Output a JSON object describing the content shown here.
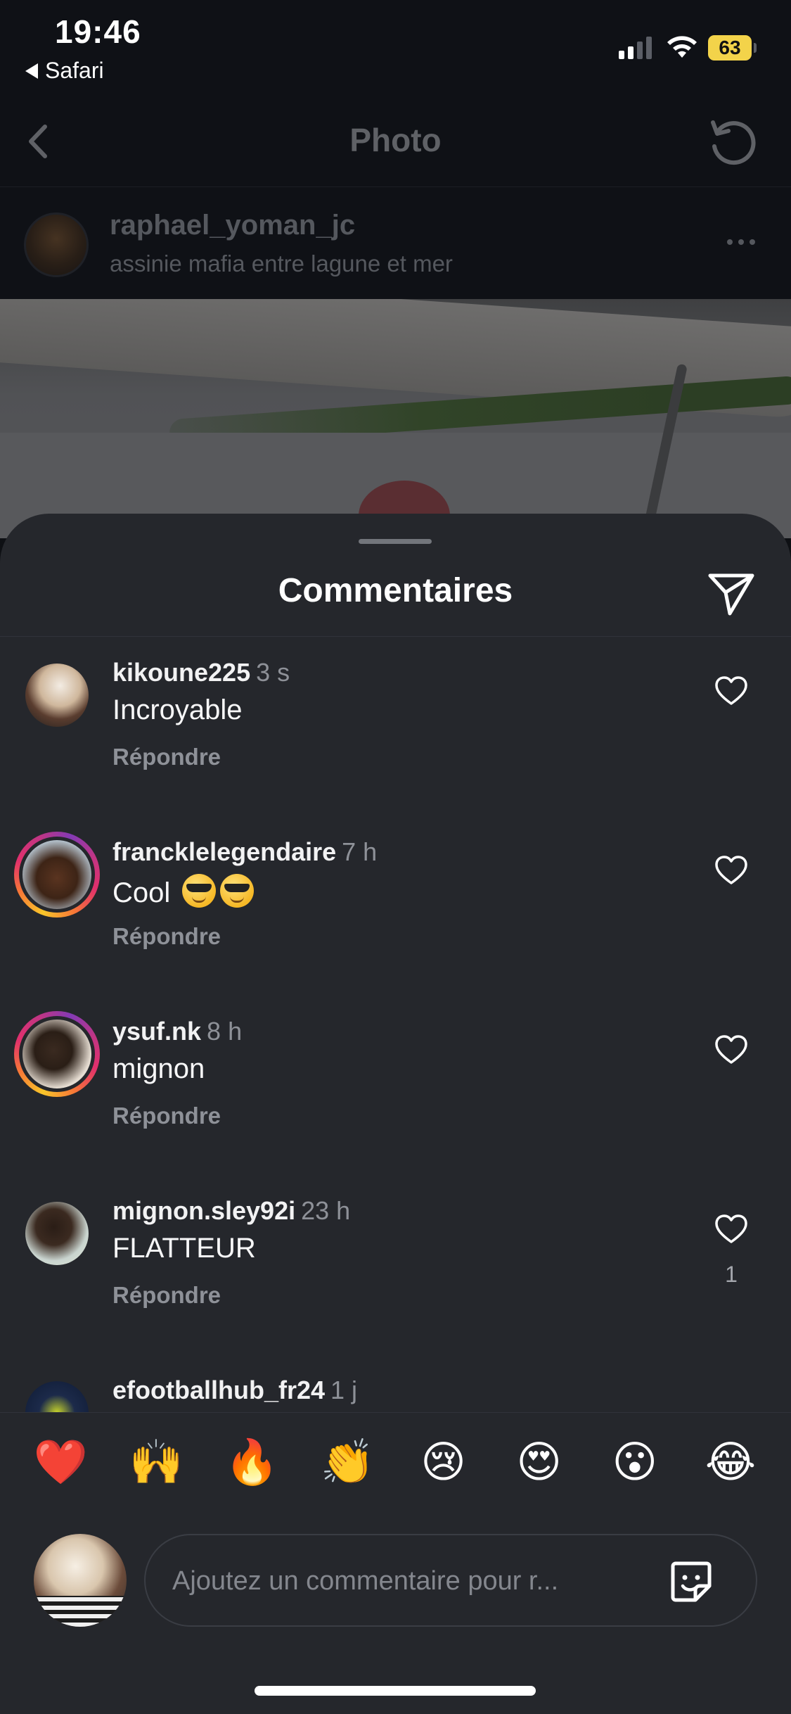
{
  "status_bar": {
    "time": "19:46",
    "back_app": "Safari",
    "battery": "63"
  },
  "nav": {
    "title": "Photo",
    "back_icon": "chevron-left-icon",
    "refresh_icon": "refresh-icon"
  },
  "post": {
    "username": "raphael_yoman_jc",
    "location": "assinie mafia entre lagune et mer"
  },
  "sheet": {
    "title": "Commentaires",
    "share_icon": "send-icon"
  },
  "comments": [
    {
      "username": "kikoune225",
      "time": "3 s",
      "text": "Incroyable",
      "reply": "Répondre",
      "likes": ""
    },
    {
      "username": "francklelegendaire",
      "time": "7 h",
      "text": "Cool",
      "reply": "Répondre",
      "likes": ""
    },
    {
      "username": "ysuf.nk",
      "time": "8 h",
      "text": "mignon",
      "reply": "Répondre",
      "likes": ""
    },
    {
      "username": "mignon.sley92i",
      "time": "23 h",
      "text": "FLATTEUR",
      "reply": "Répondre",
      "likes": "1"
    },
    {
      "username": "efootballhub_fr24",
      "time": "1 j",
      "text": "",
      "reply": "",
      "likes": ""
    }
  ],
  "reactions": [
    "❤️",
    "🙌",
    "🔥",
    "👏",
    "😢",
    "😍",
    "😮",
    "😂"
  ],
  "composer": {
    "placeholder": "Ajoutez un commentaire pour r..."
  },
  "colors": {
    "sheet_bg": "#25272c",
    "muted_text": "#8e9198",
    "story_ring": "#e1306c"
  }
}
